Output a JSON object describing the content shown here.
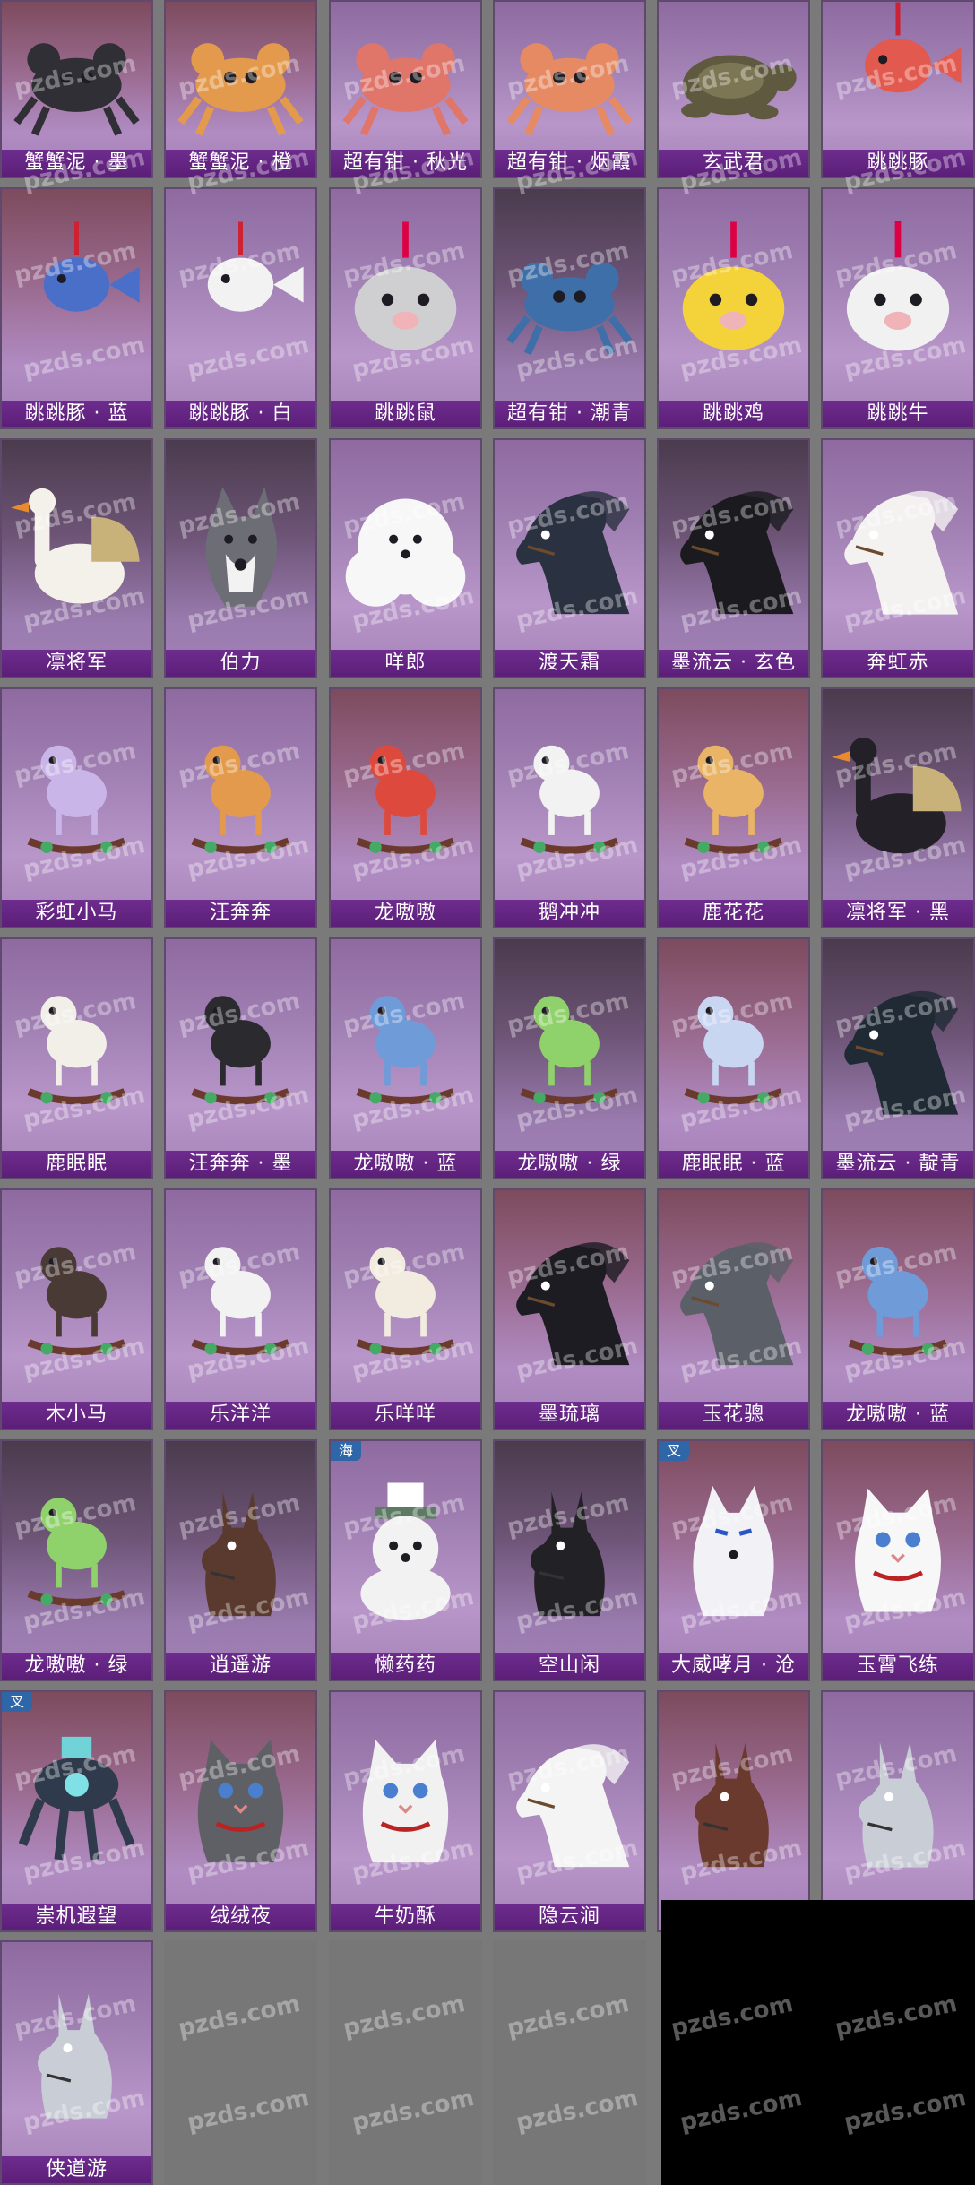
{
  "watermark": "pzds.com",
  "cards": [
    {
      "name": "蟹蟹泥 · 墨",
      "art": "crab",
      "color": "#2f2f35",
      "bg": "bg-warm"
    },
    {
      "name": "蟹蟹泥 · 橙",
      "art": "crab",
      "color": "#e39a4c",
      "bg": "bg-warm"
    },
    {
      "name": "超有钳 · 秋光",
      "art": "crab",
      "color": "#e0756a",
      "bg": ""
    },
    {
      "name": "超有钳 · 烟霞",
      "art": "crab",
      "color": "#e58a63",
      "bg": ""
    },
    {
      "name": "玄武君",
      "art": "turtle",
      "color": "#5f5a3f",
      "bg": ""
    },
    {
      "name": "跳跳豚",
      "art": "fish",
      "color": "#e25a4f",
      "bg": ""
    },
    {
      "name": "跳跳豚 · 蓝",
      "art": "fish",
      "color": "#4a6fc9",
      "bg": "bg-warm"
    },
    {
      "name": "跳跳豚 · 白",
      "art": "fish",
      "color": "#f2f2f2",
      "bg": ""
    },
    {
      "name": "跳跳鼠",
      "art": "round",
      "color": "#cfcfd2",
      "bg": ""
    },
    {
      "name": "超有钳 · 潮青",
      "art": "crab",
      "color": "#3f6fa8",
      "bg": "bg-dark"
    },
    {
      "name": "跳跳鸡",
      "art": "round",
      "color": "#f4d23a",
      "bg": ""
    },
    {
      "name": "跳跳牛",
      "art": "round",
      "color": "#f1f1f1",
      "bg": ""
    },
    {
      "name": "凛将军",
      "art": "goose",
      "color": "#f4f1ea",
      "bg": "bg-dark"
    },
    {
      "name": "伯力",
      "art": "dog",
      "color": "#6d6e75",
      "bg": "bg-dark"
    },
    {
      "name": "咩郎",
      "art": "fluffy",
      "color": "#f7f7f7",
      "bg": ""
    },
    {
      "name": "渡天霜",
      "art": "horse",
      "color": "#2a3140",
      "bg": ""
    },
    {
      "name": "墨流云 · 玄色",
      "art": "horse",
      "color": "#1b1b1f",
      "bg": "bg-dark"
    },
    {
      "name": "奔虹赤",
      "art": "horse",
      "color": "#f4f1f1",
      "bg": ""
    },
    {
      "name": "彩虹小马",
      "art": "rocking",
      "color": "#c9b5e8",
      "bg": ""
    },
    {
      "name": "汪奔奔",
      "art": "rocking",
      "color": "#e39a4c",
      "bg": ""
    },
    {
      "name": "龙嗷嗷",
      "art": "rocking",
      "color": "#dd4a3d",
      "bg": "bg-warm"
    },
    {
      "name": "鹅冲冲",
      "art": "rocking",
      "color": "#f2f2f2",
      "bg": ""
    },
    {
      "name": "鹿花花",
      "art": "rocking",
      "color": "#e9b466",
      "bg": "bg-warm"
    },
    {
      "name": "凛将军 · 黑",
      "art": "goose",
      "color": "#232027",
      "bg": "bg-dark"
    },
    {
      "name": "鹿眠眠",
      "art": "rocking",
      "color": "#f1efe8",
      "bg": ""
    },
    {
      "name": "汪奔奔 · 墨",
      "art": "rocking",
      "color": "#2b2b2f",
      "bg": ""
    },
    {
      "name": "龙嗷嗷 · 蓝",
      "art": "rocking",
      "color": "#6f9bd9",
      "bg": ""
    },
    {
      "name": "龙嗷嗷 · 绿",
      "art": "rocking",
      "color": "#8fd16a",
      "bg": "bg-dark"
    },
    {
      "name": "鹿眠眠 · 蓝",
      "art": "rocking",
      "color": "#c8d6f2",
      "bg": "bg-warm"
    },
    {
      "name": "墨流云 · 靛青",
      "art": "horse",
      "color": "#1f2a35",
      "bg": "bg-dark"
    },
    {
      "name": "木小马",
      "art": "rocking",
      "color": "#4a3a35",
      "bg": ""
    },
    {
      "name": "乐洋洋",
      "art": "rocking",
      "color": "#f2f2f2",
      "bg": ""
    },
    {
      "name": "乐咩咩",
      "art": "rocking",
      "color": "#f2ece0",
      "bg": ""
    },
    {
      "name": "墨琉璃",
      "art": "horse",
      "color": "#1c1c22",
      "bg": "bg-warm"
    },
    {
      "name": "玉花骢",
      "art": "horse",
      "color": "#5b5f68",
      "bg": "bg-warm"
    },
    {
      "name": "龙嗷嗷 · 蓝",
      "art": "rocking",
      "color": "#6f9bd9",
      "bg": "bg-warm"
    },
    {
      "name": "龙嗷嗷 · 绿",
      "art": "rocking",
      "color": "#8fd16a",
      "bg": "bg-dark"
    },
    {
      "name": "逍遥游",
      "art": "donkey",
      "color": "#5a3a2e",
      "bg": "bg-dark"
    },
    {
      "name": "懒药药",
      "art": "bear",
      "color": "#f2f2f2",
      "bg": "",
      "tag": "海"
    },
    {
      "name": "空山闲",
      "art": "donkey",
      "color": "#222226",
      "bg": "bg-dark"
    },
    {
      "name": "大威哮月 · 沧",
      "art": "wolf",
      "color": "#f2f2f6",
      "bg": "bg-warm",
      "tag": "叉"
    },
    {
      "name": "玉霄飞练",
      "art": "cat",
      "color": "#f7f7f7",
      "bg": "bg-warm"
    },
    {
      "name": "崇机遐望",
      "art": "mech",
      "color": "#2f3b4d",
      "bg": "bg-warm",
      "tag": "叉"
    },
    {
      "name": "绒绒夜",
      "art": "cat",
      "color": "#5f5f66",
      "bg": "bg-warm"
    },
    {
      "name": "牛奶酥",
      "art": "cat",
      "color": "#f1f1f1",
      "bg": ""
    },
    {
      "name": "隐云涧",
      "art": "horse",
      "color": "#f4f4f4",
      "bg": ""
    },
    {
      "name": "",
      "art": "donkey",
      "color": "#6a3a2e",
      "bg": "bg-warm"
    },
    {
      "name": "",
      "art": "donkey",
      "color": "#c9cdd6",
      "bg": ""
    },
    {
      "name": "侠道游",
      "art": "donkey",
      "color": "#c9cdd6",
      "bg": ""
    }
  ]
}
